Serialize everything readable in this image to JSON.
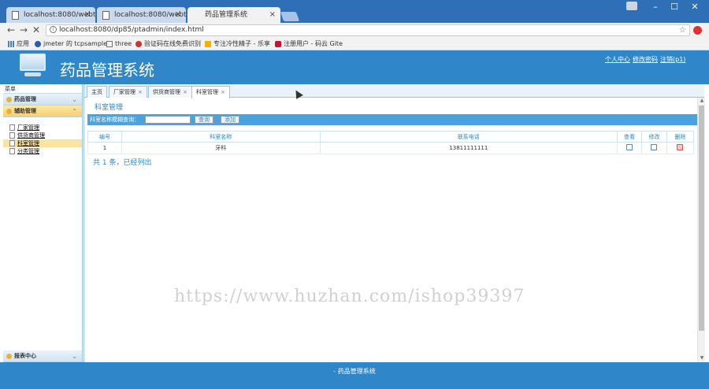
{
  "browser": {
    "tabs": [
      {
        "title": "localhost:8080/webtoo",
        "active": false
      },
      {
        "title": "localhost:8080/webtoo",
        "active": false
      },
      {
        "title": "药品管理系统",
        "active": true
      }
    ],
    "url": "localhost:8080/dp85/ptadmin/index.html",
    "bookmarks": [
      "应用",
      "jmeter 的 tcpsample",
      "three",
      "验证码在线免费识别",
      "专注冷性精子 - 乐享",
      "注册用户 - 码云 Gite"
    ]
  },
  "app": {
    "title": "药品管理系统",
    "top_links": [
      "个人中心",
      "修改密码",
      "注销(p1)"
    ]
  },
  "sidebar": {
    "header": "菜单",
    "groups": [
      {
        "label": "药品管理"
      },
      {
        "label": "辅助管理"
      }
    ],
    "items": [
      {
        "label": "厂家管理"
      },
      {
        "label": "供货商管理"
      },
      {
        "label": "科室管理"
      },
      {
        "label": "分类管理"
      }
    ],
    "bottom_group": "报表中心"
  },
  "main": {
    "tabs": [
      {
        "label": "主页"
      },
      {
        "label": "厂家管理"
      },
      {
        "label": "供货商管理"
      },
      {
        "label": "科室管理"
      }
    ],
    "section_title": "科室管理",
    "search": {
      "label": "科室名称模糊查询：",
      "value": "",
      "query_button": "查询",
      "add_button": "添加"
    },
    "table": {
      "headers": [
        "编号",
        "科室名称",
        "联系电话",
        "查看",
        "修改",
        "删除"
      ],
      "rows": [
        {
          "id": "1",
          "name": "牙科",
          "phone": "13811111111"
        }
      ]
    },
    "summary": "共 1 条，已经列出"
  },
  "watermark": "https://www.huzhan.com/ishop39397",
  "footer": "- 药品管理系统"
}
